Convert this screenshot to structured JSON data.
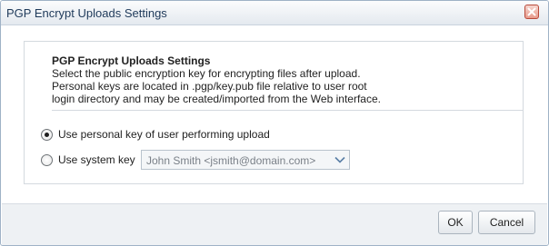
{
  "dialog": {
    "title": "PGP Encrypt Uploads Settings",
    "close_icon": "close-icon"
  },
  "info": {
    "heading": "PGP Encrypt Uploads Settings",
    "lines": [
      "Select the public encryption key for encrypting files after upload.",
      "Personal keys are located in .pgp/key.pub file relative to user root",
      "login directory and may be created/imported from the Web interface."
    ]
  },
  "options": [
    {
      "label": "Use personal key of user performing upload",
      "checked": true
    },
    {
      "label": "Use system key",
      "checked": false
    }
  ],
  "system_key_select": {
    "value": "John Smith <jsmith@domain.com>",
    "arrow_icon": "chevron-down-icon"
  },
  "footer": {
    "ok_label": "OK",
    "cancel_label": "Cancel"
  },
  "colors": {
    "title_text": "#1f3a5a",
    "close_button": "#e89a8b",
    "border": "#9fb2c6"
  }
}
